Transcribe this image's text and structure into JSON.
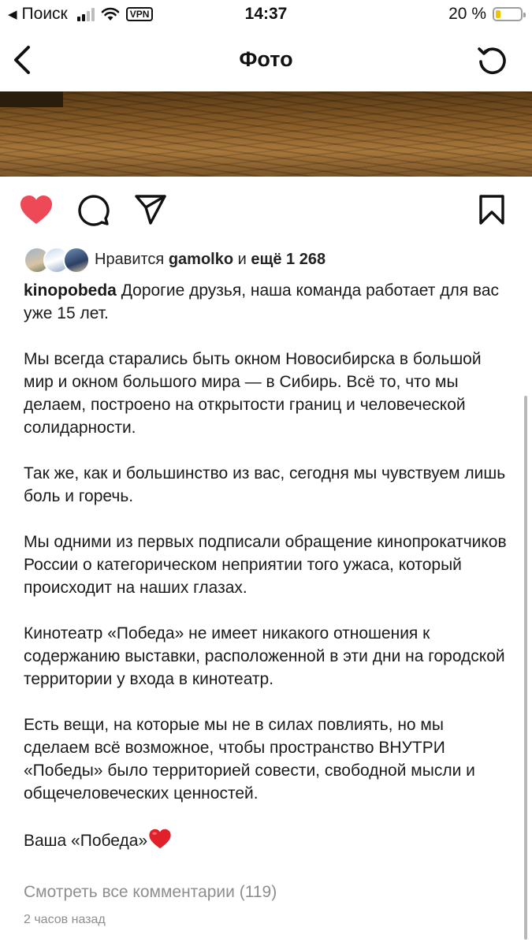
{
  "status_bar": {
    "back_label": "Поиск",
    "vpn": "VPN",
    "time": "14:37",
    "battery_text": "20 %",
    "battery_level": 0.2
  },
  "nav": {
    "title": "Фото"
  },
  "post": {
    "likes": {
      "prefix": "Нравится",
      "user": "gamolko",
      "middle": "и",
      "more": "ещё 1 268"
    },
    "caption": {
      "username": "kinopobeda",
      "intro": "Дорогие друзья, наша команда работает для вас уже 15 лет.",
      "p1": "Мы всегда старались быть окном Новосибирска в большой мир и окном большого мира — в Сибирь. Всё то, что мы делаем, построено на открытости границ и человеческой солидарности.",
      "p2": "Так же, как и большинство из вас, сегодня мы чувствуем лишь боль и горечь.",
      "p3": "Мы одними из первых подписали обращение кинопрокатчиков России о категорическом неприятии того ужаса, который происходит на наших глазах.",
      "p4": "Кинотеатр «Победа» не имеет никакого отношения к содержанию выставки, расположенной в эти дни на городской территории у входа в кинотеатр.",
      "p5": "Есть вещи, на которые мы не в силах повлиять, но мы сделаем всё возможное, чтобы пространство ВНУТРИ «Победы» было территорией совести, свободной мысли и общечеловеческих ценностей.",
      "signature": "Ваша «Победа»"
    },
    "view_comments": "Смотреть все комментарии (119)",
    "time_ago": "2 часов назад"
  },
  "colors": {
    "like_red": "#ed4956",
    "muted_gray": "#8e8e8e"
  },
  "icons": [
    "back-arrow-icon",
    "refresh-icon",
    "heart-icon",
    "comment-icon",
    "share-icon",
    "bookmark-icon"
  ]
}
